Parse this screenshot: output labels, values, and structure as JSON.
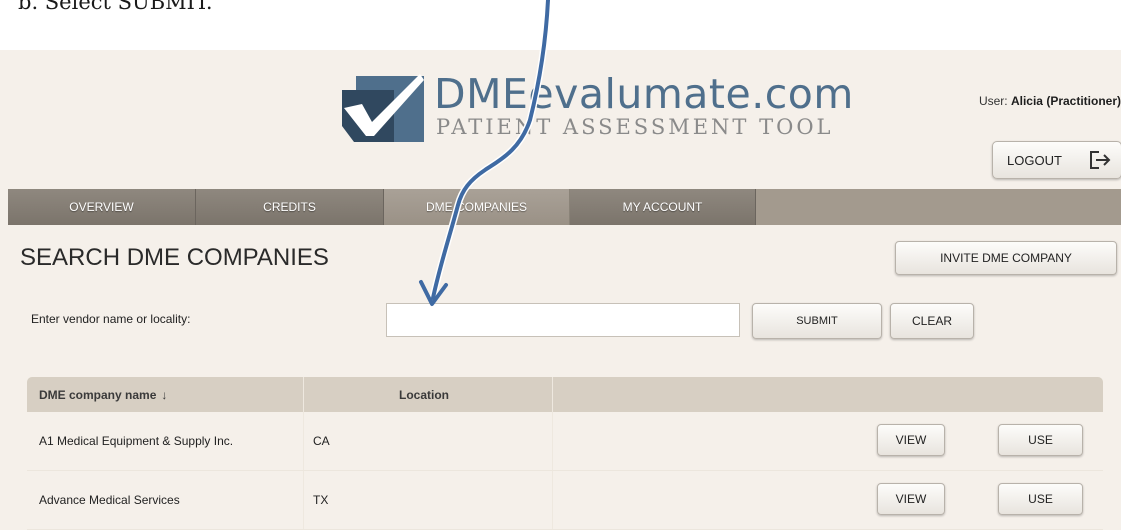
{
  "instruction": {
    "text": "b. Select SUBMIT."
  },
  "brand": {
    "name": "DMEevalumate.com",
    "tagline": "PATIENT ASSESSMENT TOOL",
    "colors": {
      "primary": "#4f6f8c",
      "dark": "#30485f",
      "check": "#ffffff"
    }
  },
  "user": {
    "prefix": "User:",
    "name": "Alicia (Practitioner)"
  },
  "logout": {
    "label": "LOGOUT",
    "icon": "logout-icon"
  },
  "tabs": [
    {
      "label": "OVERVIEW",
      "active": false
    },
    {
      "label": "CREDITS",
      "active": false
    },
    {
      "label": "DME COMPANIES",
      "active": true
    },
    {
      "label": "MY ACCOUNT",
      "active": false
    }
  ],
  "page": {
    "title": "SEARCH DME COMPANIES",
    "invite_label": "INVITE DME COMPANY"
  },
  "search": {
    "label": "Enter vendor name or locality:",
    "value": "",
    "placeholder": "",
    "submit_label": "SUBMIT",
    "clear_label": "CLEAR"
  },
  "table": {
    "columns": [
      {
        "label": "DME company name",
        "sort_icon": "arrow-down-icon",
        "sort_glyph": "↓"
      },
      {
        "label": "Location"
      }
    ],
    "rows": [
      {
        "name": "A1 Medical Equipment & Supply Inc.",
        "location": "CA",
        "view_label": "VIEW",
        "use_label": "USE"
      },
      {
        "name": "Advance Medical Services",
        "location": "TX",
        "view_label": "VIEW",
        "use_label": "USE"
      }
    ]
  },
  "annotation": {
    "color": "#3f6aa3",
    "target": "search-input"
  }
}
